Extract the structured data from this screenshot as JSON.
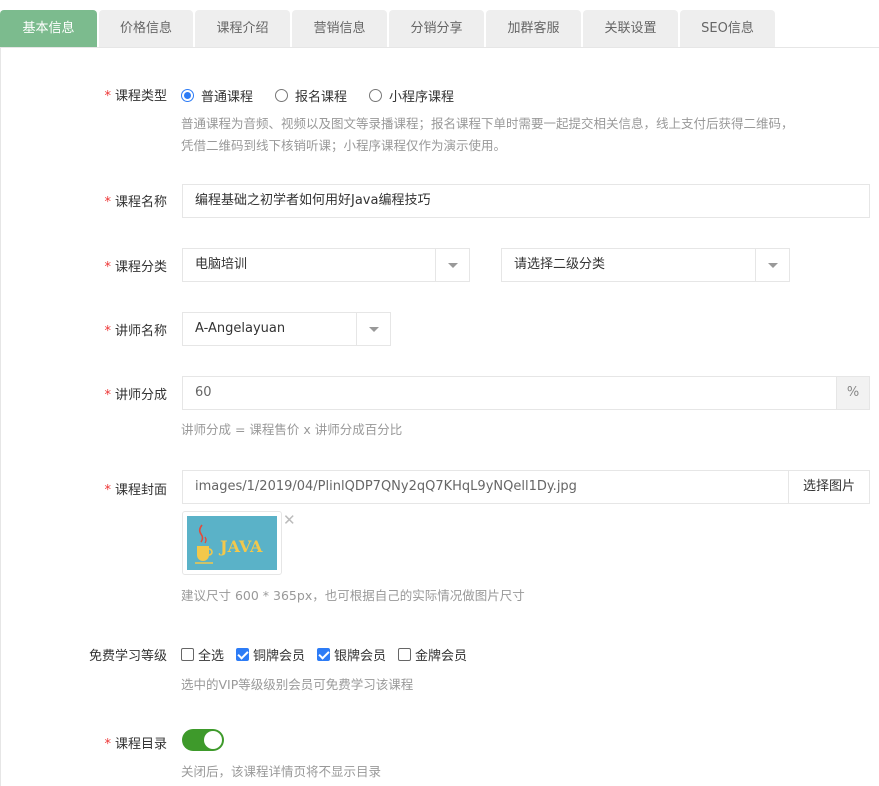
{
  "tabs": [
    {
      "label": "基本信息",
      "active": true
    },
    {
      "label": "价格信息",
      "active": false
    },
    {
      "label": "课程介绍",
      "active": false
    },
    {
      "label": "营销信息",
      "active": false
    },
    {
      "label": "分销分享",
      "active": false
    },
    {
      "label": "加群客服",
      "active": false
    },
    {
      "label": "关联设置",
      "active": false
    },
    {
      "label": "SEO信息",
      "active": false
    }
  ],
  "form": {
    "course_type": {
      "label": "课程类型",
      "options": [
        "普通课程",
        "报名课程",
        "小程序课程"
      ],
      "selected": "普通课程",
      "hint_line1": "普通课程为音频、视频以及图文等录播课程；报名课程下单时需要一起提交相关信息，线上支付后获得二维码，",
      "hint_line2": "凭借二维码到线下核销听课；小程序课程仅作为演示使用。"
    },
    "course_name": {
      "label": "课程名称",
      "value": "编程基础之初学者如何用好Java编程技巧"
    },
    "course_category": {
      "label": "课程分类",
      "primary": "电脑培训",
      "secondary": "请选择二级分类"
    },
    "teacher_name": {
      "label": "讲师名称",
      "value": "A-Angelayuan"
    },
    "teacher_share": {
      "label": "讲师分成",
      "value": "60",
      "unit": "%",
      "hint": "讲师分成 = 课程售价 x 讲师分成百分比"
    },
    "course_cover": {
      "label": "课程封面",
      "path": "images/1/2019/04/PlinlQDP7QNy2qQ7KHqL9yNQell1Dy.jpg",
      "select_button": "选择图片",
      "thumb_text": "JAVA",
      "remove_icon": "close-icon",
      "hint": "建议尺寸 600 * 365px，也可根据自己的实际情况做图片尺寸"
    },
    "free_level": {
      "label": "免费学习等级",
      "options": [
        {
          "label": "全选",
          "checked": false
        },
        {
          "label": "铜牌会员",
          "checked": true
        },
        {
          "label": "银牌会员",
          "checked": true
        },
        {
          "label": "金牌会员",
          "checked": false
        }
      ],
      "hint": "选中的VIP等级级别会员可免费学习该课程"
    },
    "course_catalog": {
      "label": "课程目录",
      "enabled": true,
      "hint": "关闭后，该课程详情页将不显示目录"
    },
    "required_mark": "*"
  },
  "colors": {
    "tab_active": "#7cbb8e",
    "tab_inactive": "#eeeeee",
    "required": "#e33333",
    "accent": "#2d7cf6",
    "switch_on": "#3e9a2b"
  }
}
